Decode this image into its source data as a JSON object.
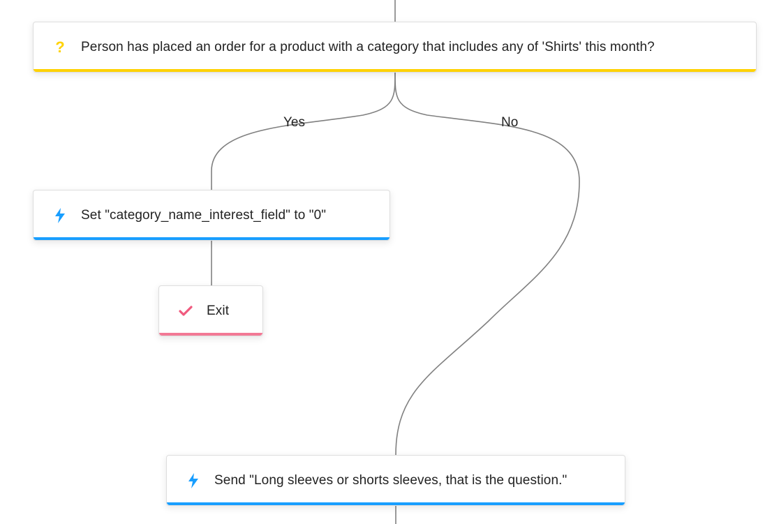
{
  "decision": {
    "text": "Person has placed an order for a product with a category that includes any of 'Shirts' this month?",
    "icon": "?"
  },
  "branches": {
    "yes_label": "Yes",
    "no_label": "No"
  },
  "set_field": {
    "text": "Set \"category_name_interest_field\" to \"0\""
  },
  "exit": {
    "text": "Exit"
  },
  "send": {
    "text": "Send \"Long sleeves or shorts sleeves, that is the question.\""
  },
  "colors": {
    "decision_stripe": "#ffd200",
    "action_stripe": "#189eff",
    "exit_stripe": "#f27995",
    "connector": "#808080"
  }
}
